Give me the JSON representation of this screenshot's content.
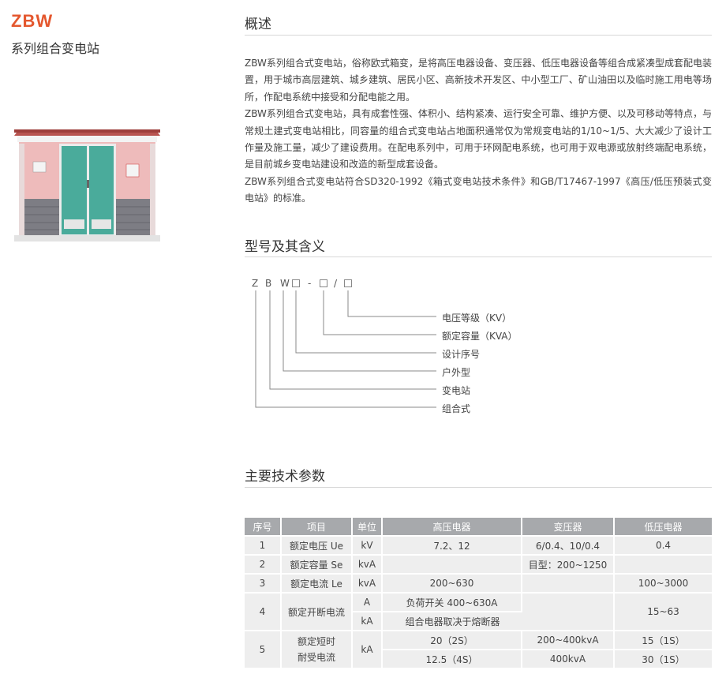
{
  "product": {
    "code": "ZBW",
    "subtitle": "系列组合变电站"
  },
  "overview": {
    "title": "概述",
    "paragraphs": [
      "ZBW系列组合式变电站，俗称欧式箱变，是将高压电器设备、变压器、低压电器设备等组合成紧凑型成套配电装置，用于城市高层建筑、城乡建筑、居民小区、高新技术开发区、中小型工厂、矿山油田以及临时施工用电等场所，作配电系统中接受和分配电能之用。",
      "ZBW系列组合式变电站，具有成套性强、体积小、结构紧凑、运行安全可靠、维护方便、以及可移动等特点，与常规土建式变电站相比，同容量的组合式变电站占地面积通常仅为常规变电站的1/10~1/5、大大减少了设计工作量及施工量，减少了建设费用。在配电系列中，可用于环网配电系统，也可用于双电源或放射终端配电系统，是目前城乡变电站建设和改造的新型成套设备。",
      "ZBW系列组合式变电站符合SD320-1992《箱式变电站技术条件》和GB/T17467-1997《高压/低压预装式变电站》的标准。"
    ]
  },
  "model": {
    "title": "型号及其含义",
    "chars": [
      "Z",
      "B",
      "W",
      "-",
      "/"
    ],
    "legend": [
      "电压等级（KV）",
      "额定容量（KVA）",
      "设计序号",
      "户外型",
      "变电站",
      "组合式"
    ]
  },
  "specs": {
    "title": "主要技术参数",
    "headers": [
      "序号",
      "项目",
      "单位",
      "高压电器",
      "变压器",
      "低压电器"
    ],
    "rows": {
      "r1": {
        "no": "1",
        "item": "额定电压 Ue",
        "unit": "kV",
        "hv": "7.2、12",
        "tr": "6/0.4、10/0.4",
        "lv": "0.4"
      },
      "r2": {
        "no": "2",
        "item": "额定容量 Se",
        "unit": "kvA",
        "hv": "",
        "tr": "目型：200~1250",
        "lv": ""
      },
      "r3": {
        "no": "3",
        "item": "额定电流 Le",
        "unit": "kvA",
        "hv": "200~630",
        "tr": "",
        "lv": "100~3000"
      },
      "r4": {
        "no": "4",
        "item": "额定开断电流",
        "unit_a": "A",
        "hv_a": "负荷开关 400~630A",
        "unit_b": "kA",
        "hv_b": "组合电器取决于熔断器",
        "tr": "",
        "lv": "15~63"
      },
      "r5": {
        "no": "5",
        "item_a": "额定短时",
        "item_b": "耐受电流",
        "unit": "kA",
        "hv_a": "20（2S）",
        "tr_a": "200~400kvA",
        "lv_a": "15（1S）",
        "hv_b": "12.5（4S）",
        "tr_b": "400kvA",
        "lv_b": "30（1S）"
      }
    }
  }
}
